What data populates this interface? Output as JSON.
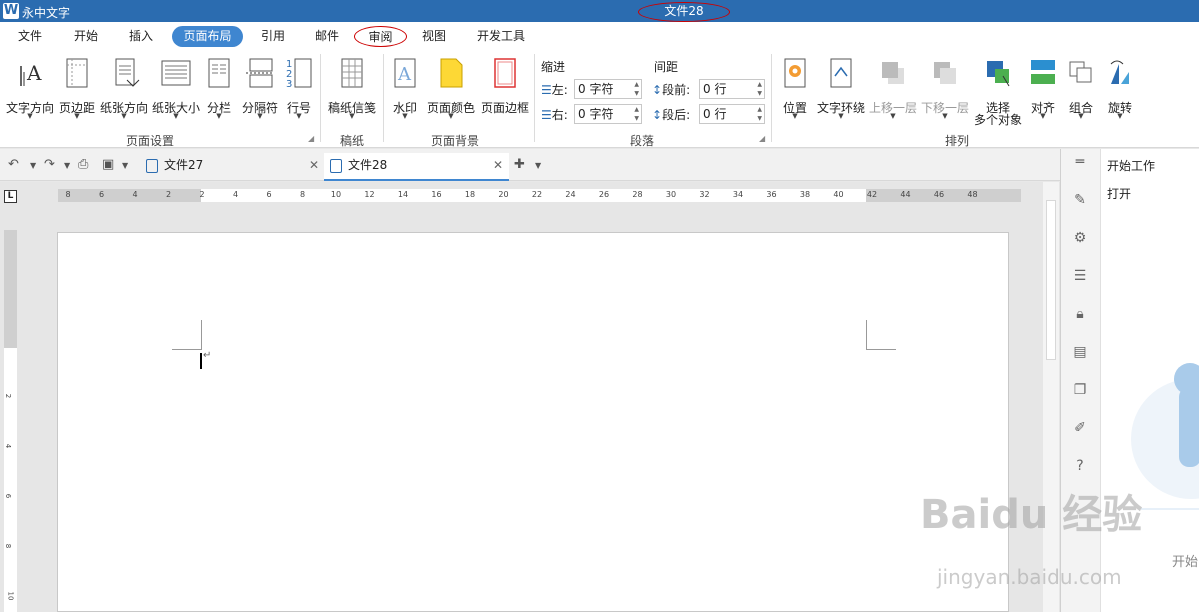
{
  "titlebar": {
    "app_name": "永中文字",
    "doc_title": "文件28"
  },
  "menu": {
    "tabs": [
      "文件",
      "开始",
      "插入",
      "页面布局",
      "引用",
      "邮件",
      "审阅",
      "视图",
      "开发工具"
    ],
    "active_tab": "页面布局"
  },
  "ribbon": {
    "page_setup": {
      "text_direction": "文字方向",
      "margins": "页边距",
      "orientation": "纸张方向",
      "size": "纸张大小",
      "columns": "分栏",
      "breaks": "分隔符",
      "line_numbers": "行号",
      "group_label": "页面设置"
    },
    "manuscript": {
      "manuscript_paper": "稿纸信笺",
      "group_label": "稿纸"
    },
    "page_background": {
      "watermark": "水印",
      "page_color": "页面颜色",
      "page_border": "页面边框",
      "group_label": "页面背景"
    },
    "paragraph": {
      "indent_header": "缩进",
      "spacing_header": "间距",
      "left_label": "左:",
      "left_value": "0 字符",
      "right_label": "右:",
      "right_value": "0 字符",
      "before_label": "段前:",
      "before_value": "0 行",
      "after_label": "段后:",
      "after_value": "0 行",
      "group_label": "段落"
    },
    "arrange": {
      "position": "位置",
      "wrap_text": "文字环绕",
      "bring_forward": "上移一层",
      "send_backward": "下移一层",
      "select_multiple_1": "选择",
      "select_multiple_2": "多个对象",
      "align": "对齐",
      "group": "组合",
      "rotate": "旋转",
      "group_label": "排列"
    }
  },
  "doc_tabs": [
    {
      "name": "文件27",
      "active": false
    },
    {
      "name": "文件28",
      "active": true
    }
  ],
  "ruler": {
    "h_ticks": [
      "8",
      "6",
      "4",
      "2",
      "2",
      "4",
      "6",
      "8",
      "10",
      "12",
      "14",
      "16",
      "18",
      "20",
      "22",
      "24",
      "26",
      "28",
      "30",
      "32",
      "34",
      "36",
      "38",
      "40",
      "42",
      "44",
      "46",
      "48"
    ],
    "v_ticks": [
      "2",
      "4",
      "6",
      "8",
      "10"
    ],
    "corner": "L"
  },
  "right_pane": {
    "title": "开始工作",
    "open": "打开",
    "footer": "开始"
  },
  "watermark": {
    "brand": "Baidu 经验",
    "url": "jingyan.baidu.com"
  },
  "colors": {
    "title_bar": "#2b6cb0",
    "active_tab": "#3f86d0",
    "annotation": "#cc0000"
  }
}
